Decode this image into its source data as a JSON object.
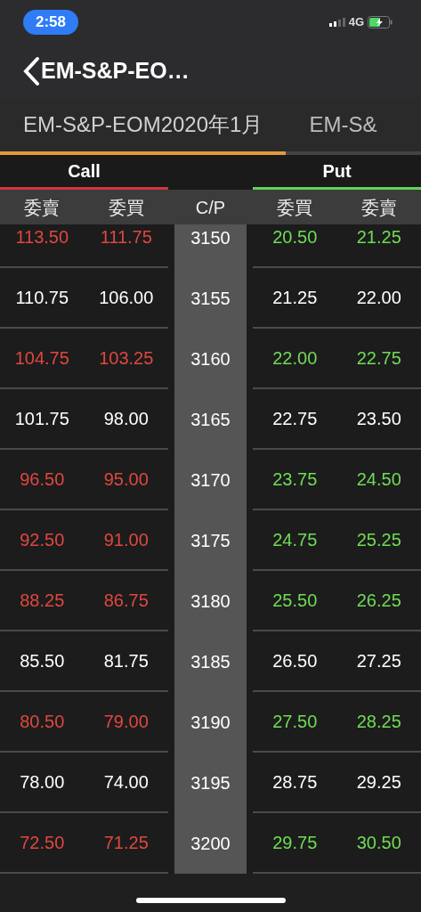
{
  "status_bar": {
    "time": "2:58",
    "network": "4G"
  },
  "nav": {
    "title": "EM-S&P-EO…"
  },
  "tabs": [
    {
      "label": "EM-S&P-EOM2020年1月",
      "selected": true
    },
    {
      "label": "EM-S&",
      "selected": false
    }
  ],
  "sides": {
    "call": "Call",
    "put": "Put"
  },
  "columns": [
    "委賣",
    "委買",
    "C/P",
    "委買",
    "委賣"
  ],
  "rows": [
    {
      "call_ask": "113.50",
      "call_bid": "111.75",
      "strike": "3150",
      "put_bid": "20.50",
      "put_ask": "21.25",
      "highlight": true
    },
    {
      "call_ask": "110.75",
      "call_bid": "106.00",
      "strike": "3155",
      "put_bid": "21.25",
      "put_ask": "22.00",
      "highlight": false
    },
    {
      "call_ask": "104.75",
      "call_bid": "103.25",
      "strike": "3160",
      "put_bid": "22.00",
      "put_ask": "22.75",
      "highlight": true
    },
    {
      "call_ask": "101.75",
      "call_bid": "98.00",
      "strike": "3165",
      "put_bid": "22.75",
      "put_ask": "23.50",
      "highlight": false
    },
    {
      "call_ask": "96.50",
      "call_bid": "95.00",
      "strike": "3170",
      "put_bid": "23.75",
      "put_ask": "24.50",
      "highlight": true
    },
    {
      "call_ask": "92.50",
      "call_bid": "91.00",
      "strike": "3175",
      "put_bid": "24.75",
      "put_ask": "25.25",
      "highlight": true
    },
    {
      "call_ask": "88.25",
      "call_bid": "86.75",
      "strike": "3180",
      "put_bid": "25.50",
      "put_ask": "26.25",
      "highlight": true
    },
    {
      "call_ask": "85.50",
      "call_bid": "81.75",
      "strike": "3185",
      "put_bid": "26.50",
      "put_ask": "27.25",
      "highlight": false
    },
    {
      "call_ask": "80.50",
      "call_bid": "79.00",
      "strike": "3190",
      "put_bid": "27.50",
      "put_ask": "28.25",
      "highlight": true
    },
    {
      "call_ask": "78.00",
      "call_bid": "74.00",
      "strike": "3195",
      "put_bid": "28.75",
      "put_ask": "29.25",
      "highlight": false
    },
    {
      "call_ask": "72.50",
      "call_bid": "71.25",
      "strike": "3200",
      "put_bid": "29.75",
      "put_ask": "30.50",
      "highlight": true
    }
  ]
}
